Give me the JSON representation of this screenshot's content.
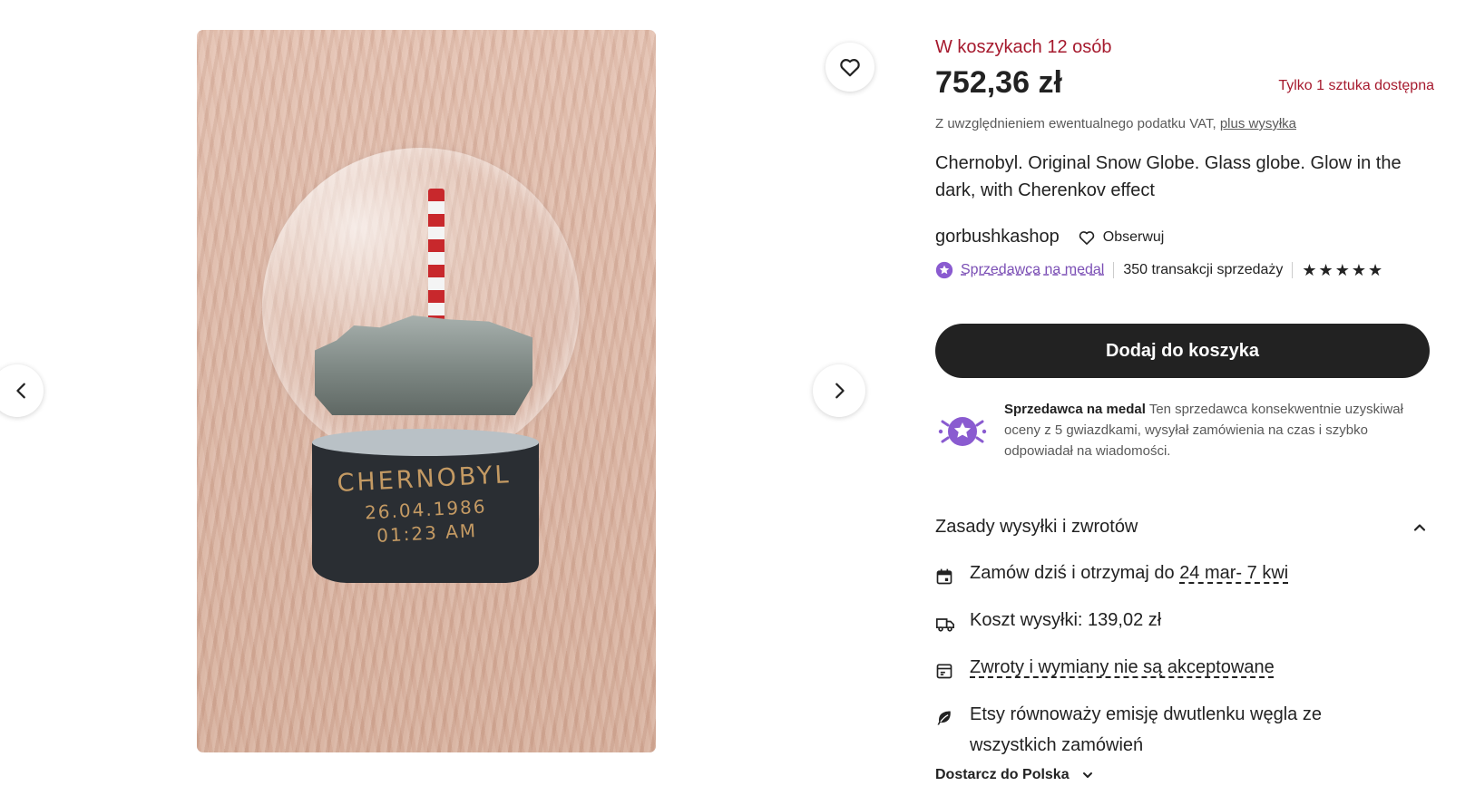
{
  "gallery": {
    "photo_alt": "",
    "base_text": {
      "line1": "CHERNOBYL",
      "line2": "26.04.1986",
      "line3": "01:23 AM"
    }
  },
  "listing": {
    "basket_note": "W koszykach 12 osób",
    "price": "752,36 zł",
    "stock_note": "Tylko 1 sztuka dostępna",
    "vat_prefix": "Z uwzględnieniem ewentualnego podatku VAT,",
    "vat_link": "plus wysyłka",
    "title": "Chernobyl. Original Snow Globe. Glass globe. Glow in the dark, with Cherenkov effect"
  },
  "shop": {
    "name": "gorbushkashop",
    "follow_label": "Obserwuj",
    "medal_label": "Sprzedawca na medal",
    "sales": "350 transakcji sprzedaży",
    "rating_stars": 5
  },
  "cart": {
    "button_label": "Dodaj do koszyka"
  },
  "medal_box": {
    "title": "Sprzedawca na medal",
    "text": "Ten sprzedawca konsekwentnie uzyskiwał oceny z 5 gwiazdkami, wysyłał zamówienia na czas i szybko odpowiadał na wiadomości."
  },
  "shipping": {
    "title": "Zasady wysyłki i zwrotów",
    "order_prefix": "Zamów dziś i otrzymaj do",
    "order_dates": "24 mar- 7 kwi",
    "cost": "Koszt wysyłki: 139,02 zł",
    "returns": "Zwroty i wymiany nie są akceptowane",
    "carbon_line1": "Etsy równoważy emisję dwutlenku węgla ze",
    "carbon_line2": "wszystkich zamówień",
    "deliver_to": "Dostarcz do Polska"
  },
  "colors": {
    "accent_red": "#a61a2e",
    "medal_purple": "#7b4fb5",
    "cta": "#222222"
  },
  "icons": [
    "heart-icon",
    "chevron-left-icon",
    "chevron-right-icon",
    "star-badge-icon",
    "calendar-icon",
    "truck-icon",
    "returns-box-icon",
    "leaf-icon",
    "chevron-up-icon",
    "chevron-down-icon"
  ]
}
